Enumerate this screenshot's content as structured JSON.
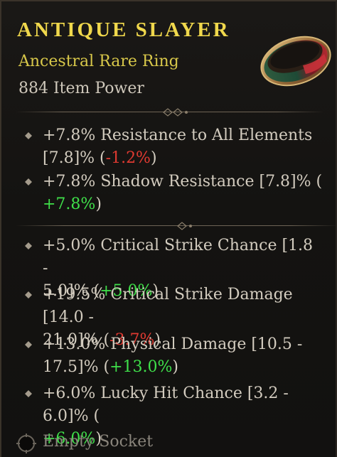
{
  "item": {
    "name": "ANTIQUE SLAYER",
    "type": "Ancestral Rare Ring",
    "power": "884 Item Power"
  },
  "implicits": [
    {
      "line1": "+7.8% Resistance to All Elements",
      "line2_pre": "[7.8]% (",
      "delta": "-1.2%",
      "line2_post": ")"
    },
    {
      "line1": "+7.8% Shadow Resistance [7.8]% (",
      "line2_pre": "",
      "delta": "+7.8%",
      "line2_post": ")"
    }
  ],
  "affixes": [
    {
      "line1": "+5.0% Critical Strike Chance [1.8 -",
      "line2_pre": "5.0]% (",
      "delta": "+5.0%",
      "line2_post": ")"
    },
    {
      "line1": "+19.5% Critical Strike Damage [14.0 -",
      "line2_pre": "21.0]% (",
      "delta": "-3.7%",
      "line2_post": ")"
    },
    {
      "line1": "+13.0% Physical Damage [10.5 -",
      "line2_pre": "17.5]% (",
      "delta": "+13.0%",
      "line2_post": ")"
    },
    {
      "line1": "+6.0% Lucky Hit Chance [3.2 - 6.0]% (",
      "line2_pre": "",
      "delta": "+6.0%",
      "line2_post": ")"
    }
  ],
  "socket": {
    "label": "Empty Socket",
    "icon": "socket-icon"
  },
  "colors": {
    "title": "#f0d84c",
    "rare": "#d8c84a",
    "negative": "#e03a31",
    "positive": "#3fe04a"
  }
}
